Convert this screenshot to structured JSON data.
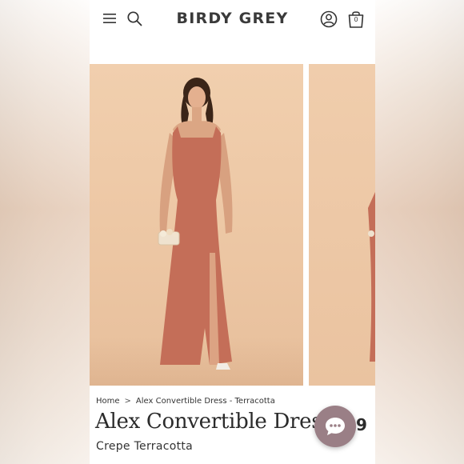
{
  "header": {
    "brand": "BIRDY GREY",
    "bag_count": "0",
    "icons": [
      "menu-icon",
      "search-icon",
      "account-icon",
      "shopping-bag-icon"
    ]
  },
  "breadcrumb": {
    "home": "Home",
    "separator": ">",
    "current": "Alex Convertible Dress - Terracotta"
  },
  "product": {
    "title": "Alex Convertible Dress",
    "subtitle": "Crepe Terracotta",
    "price_partial": "9"
  },
  "chat": {
    "icon": "chat-bubble-icon"
  },
  "colors": {
    "dress": "#c46e58",
    "backdrop": "#efcaa8",
    "chat_button": "#9a7f86",
    "text": "#2b2b2b"
  }
}
